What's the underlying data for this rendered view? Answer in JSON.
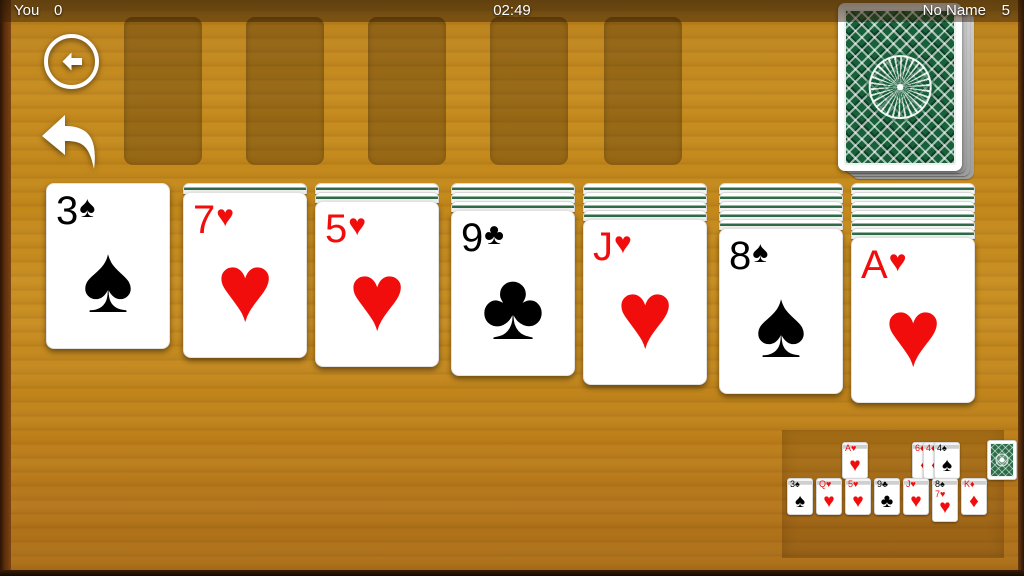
{
  "header": {
    "player_label": "You",
    "player_score": "0",
    "timer": "02:49",
    "opponent_label": "No Name",
    "opponent_score": "5"
  },
  "controls": {
    "back_button": "back-arrow",
    "undo_button": "undo-arrow"
  },
  "foundations": {
    "count": 5,
    "slots": [
      {
        "index": 1,
        "card": ""
      },
      {
        "index": 2,
        "card": ""
      },
      {
        "index": 3,
        "card": ""
      },
      {
        "index": 4,
        "card": ""
      },
      {
        "index": 5,
        "card": ""
      }
    ]
  },
  "stock": {
    "label": "stock-pile",
    "face_down": true
  },
  "colors": {
    "wood_light": "#c98f22",
    "wood_dark": "#a96c16",
    "card_red": "#f20d0d",
    "card_black": "#000000",
    "card_back_green": "#17603a",
    "header_overlay": "#2b1604"
  },
  "tableau": {
    "columns": [
      {
        "index": 1,
        "facedown": 0,
        "rank": "3",
        "suit": "♠",
        "color": "black",
        "suit_name": "spades"
      },
      {
        "index": 2,
        "facedown": 1,
        "rank": "7",
        "suit": "♥",
        "color": "red",
        "suit_name": "hearts"
      },
      {
        "index": 3,
        "facedown": 2,
        "rank": "5",
        "suit": "♥",
        "color": "red",
        "suit_name": "hearts"
      },
      {
        "index": 4,
        "facedown": 3,
        "rank": "9",
        "suit": "♣",
        "color": "black",
        "suit_name": "clubs"
      },
      {
        "index": 5,
        "facedown": 4,
        "rank": "J",
        "suit": "♥",
        "color": "red",
        "suit_name": "hearts"
      },
      {
        "index": 6,
        "facedown": 5,
        "rank": "8",
        "suit": "♠",
        "color": "black",
        "suit_name": "spades"
      },
      {
        "index": 7,
        "facedown": 6,
        "rank": "A",
        "suit": "♥",
        "color": "red",
        "suit_name": "hearts"
      }
    ]
  },
  "minimap": {
    "top_row": [
      {
        "slot": 1,
        "rank": "A",
        "suit": "♥",
        "color": "red",
        "suit_name": "hearts"
      },
      {
        "slot": 2,
        "stack": [
          {
            "rank": "6",
            "suit": "♦",
            "color": "red",
            "suit_name": "diamonds"
          },
          {
            "rank": "4",
            "suit": "♦",
            "color": "red",
            "suit_name": "diamonds"
          },
          {
            "rank": "4",
            "suit": "♠",
            "color": "black",
            "suit_name": "spades"
          }
        ]
      },
      {
        "slot": 3,
        "facedown": true
      }
    ],
    "bottom_row": [
      {
        "rank": "3",
        "suit": "♠",
        "color": "black",
        "suit_name": "spades",
        "second": null
      },
      {
        "rank": "Q",
        "suit": "♥",
        "color": "red",
        "suit_name": "hearts",
        "second": null
      },
      {
        "rank": "5",
        "suit": "♥",
        "color": "red",
        "suit_name": "hearts",
        "second": null
      },
      {
        "rank": "9",
        "suit": "♣",
        "color": "black",
        "suit_name": "clubs",
        "second": null
      },
      {
        "rank": "J",
        "suit": "♥",
        "color": "red",
        "suit_name": "hearts",
        "second": null
      },
      {
        "rank": "8",
        "suit": "♠",
        "color": "black",
        "suit_name": "spades",
        "second": {
          "rank": "7",
          "suit": "♥",
          "color": "red",
          "suit_name": "hearts"
        }
      },
      {
        "rank": "K",
        "suit": "♦",
        "color": "red",
        "suit_name": "diamonds",
        "second": null
      }
    ]
  }
}
